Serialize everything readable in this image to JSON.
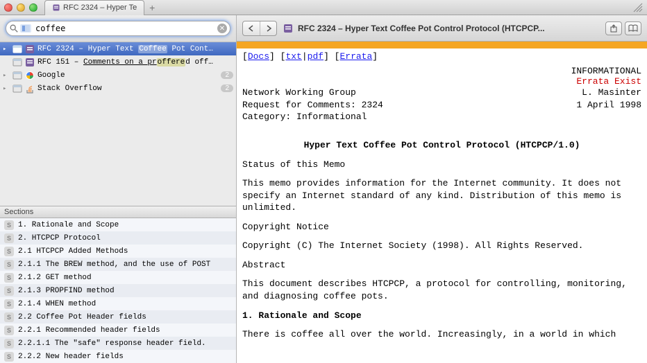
{
  "window": {
    "tab_title": "RFC 2324 – Hyper Te"
  },
  "search": {
    "value": "coffee"
  },
  "results": [
    {
      "title_pre": "RFC 2324 – Hyper Text ",
      "title_hl": "Coffee",
      "title_post": " Pot Cont…",
      "favicon": "rfc",
      "selected": true
    },
    {
      "title_pre": "RFC 151 – ",
      "title_u": "Comments on a pr",
      "title_hl": "offere",
      "title_post": "d off…",
      "favicon": "rfc"
    },
    {
      "title": "Google",
      "favicon": "google",
      "badge": "2"
    },
    {
      "title": "Stack Overflow",
      "favicon": "so",
      "badge": "2"
    }
  ],
  "sections_header": "Sections",
  "sections": [
    "1. Rationale and Scope",
    "2. HTCPCP Protocol",
    "2.1 HTCPCP Added Methods",
    "2.1.1 The BREW method, and the use of POST",
    "2.1.2 GET method",
    "2.1.3 PROPFIND method",
    "2.1.4 WHEN method",
    "2.2 Coffee Pot Header fields",
    "2.2.1 Recommended header fields",
    "2.2.1.1 The \"safe\" response header field.",
    "2.2.2 New header fields"
  ],
  "toolbar": {
    "page_title": "RFC 2324 – Hyper Text Coffee Pot Control Protocol (HTCPCP..."
  },
  "doc": {
    "links": {
      "docs": "Docs",
      "txt": "txt",
      "pdf": "pdf",
      "errata": "Errata"
    },
    "status_word": "INFORMATIONAL",
    "errata_exist": "Errata Exist",
    "header_left_1": "Network Working Group",
    "header_right_1": "L. Masinter",
    "header_left_2": "Request for Comments: 2324",
    "header_right_2": "1 April 1998",
    "header_left_3": "Category: Informational",
    "title": "Hyper Text Coffee Pot Control Protocol (HTCPCP/1.0)",
    "status_h": "Status of this Memo",
    "status_p": "This memo provides information for the Internet community.  It does not specify an Internet standard of any kind.  Distribution of this memo is unlimited.",
    "copyright_h": "Copyright Notice",
    "copyright_p": "Copyright (C) The Internet Society (1998).  All Rights Reserved.",
    "abstract_h": "Abstract",
    "abstract_p": "This document describes HTCPCP, a protocol for controlling, monitoring, and diagnosing coffee pots.",
    "section1_h": "1. Rationale and Scope",
    "section1_p": "There is coffee all over the world. Increasingly, in a world in which"
  }
}
